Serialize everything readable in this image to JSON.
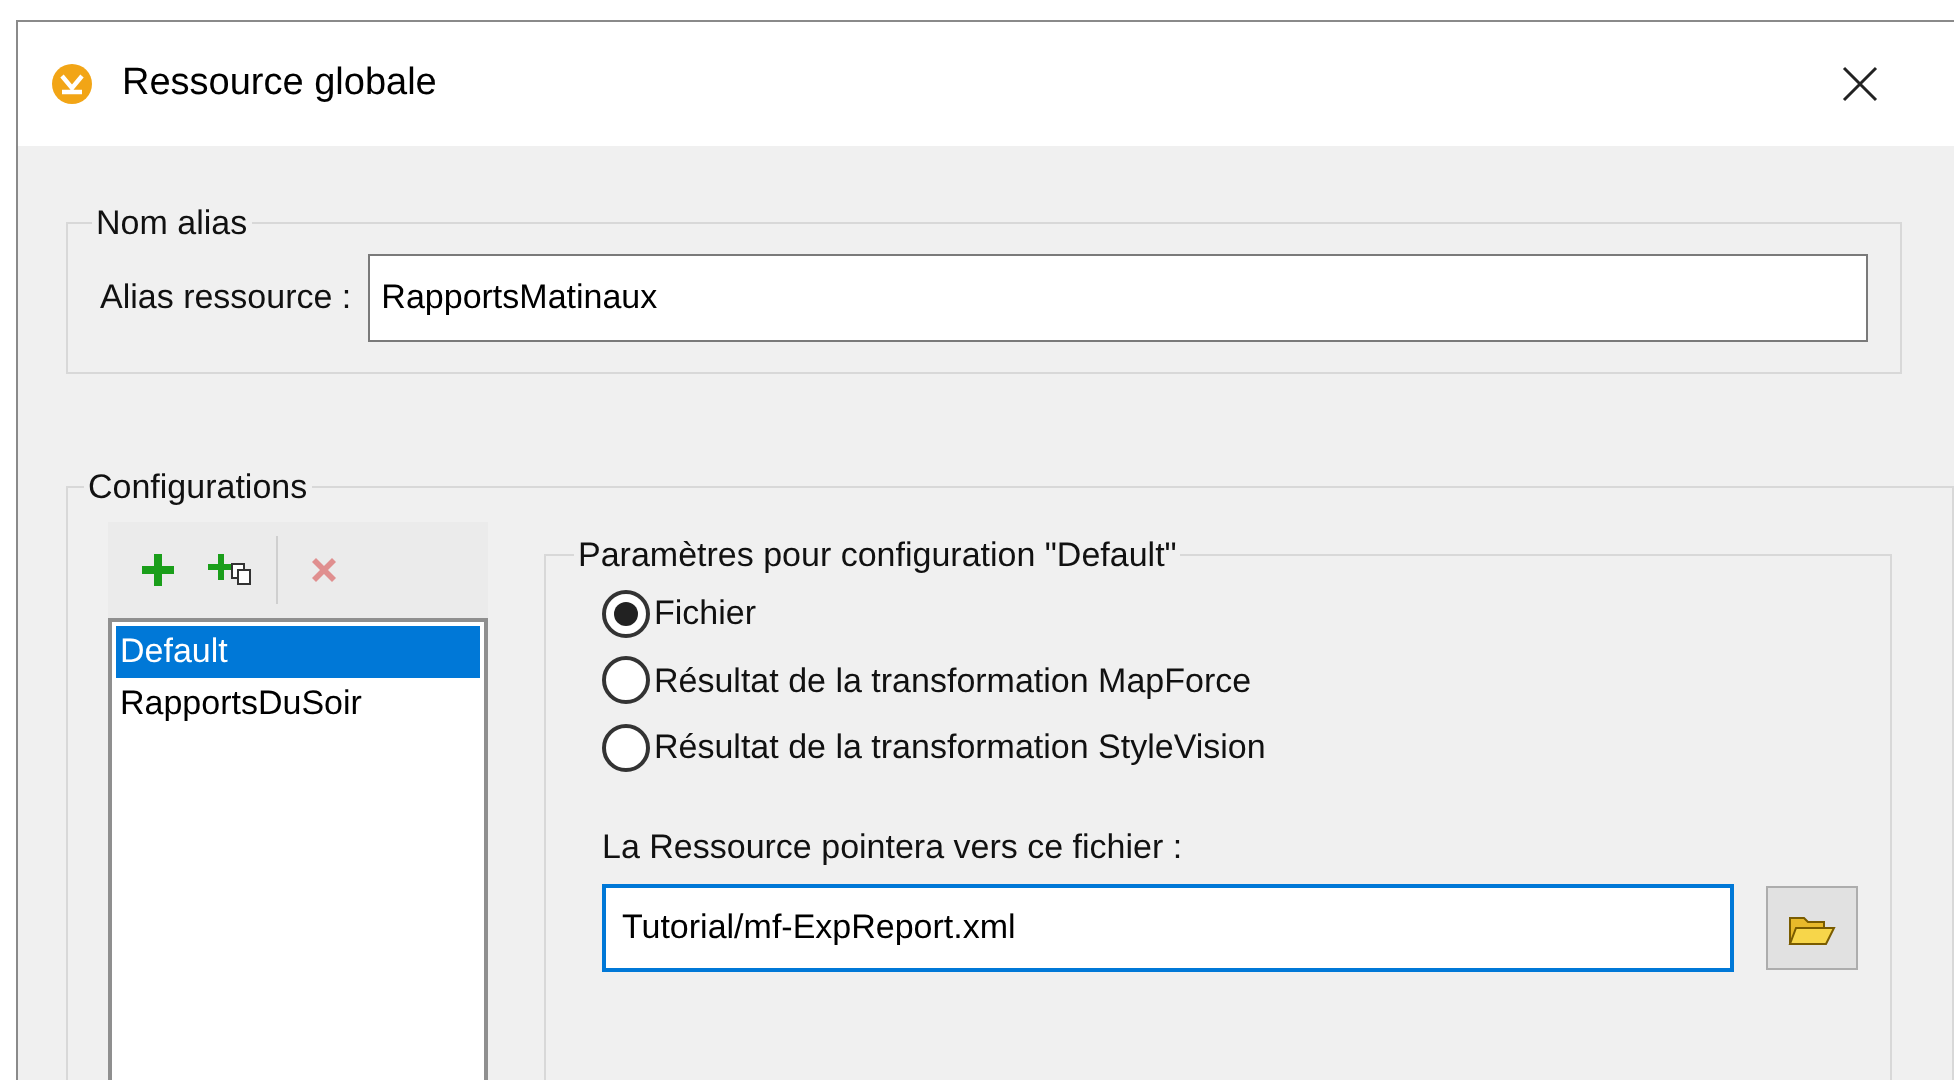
{
  "window": {
    "title": "Ressource globale"
  },
  "alias_group": {
    "title": "Nom alias",
    "label": "Alias ressource :",
    "value": "RapportsMatinaux"
  },
  "configurations": {
    "title": "Configurations",
    "toolbar": [
      {
        "kind": "add",
        "disabled": false
      },
      {
        "kind": "copy",
        "disabled": false
      },
      {
        "kind": "delete",
        "disabled": true
      }
    ],
    "items": [
      {
        "label": "Default",
        "selected": true
      },
      {
        "label": "RapportsDuSoir",
        "selected": false
      }
    ],
    "settings": {
      "title": "Paramètres pour configuration \"Default\"",
      "options": [
        {
          "label": "Fichier",
          "selected": true
        },
        {
          "label": "Résultat de la transformation MapForce",
          "selected": false
        },
        {
          "label": "Résultat de la transformation StyleVision",
          "selected": false
        }
      ],
      "file_label": "La Ressource pointera vers ce fichier :",
      "file_value": "Tutorial/mf-ExpReport.xml"
    }
  }
}
